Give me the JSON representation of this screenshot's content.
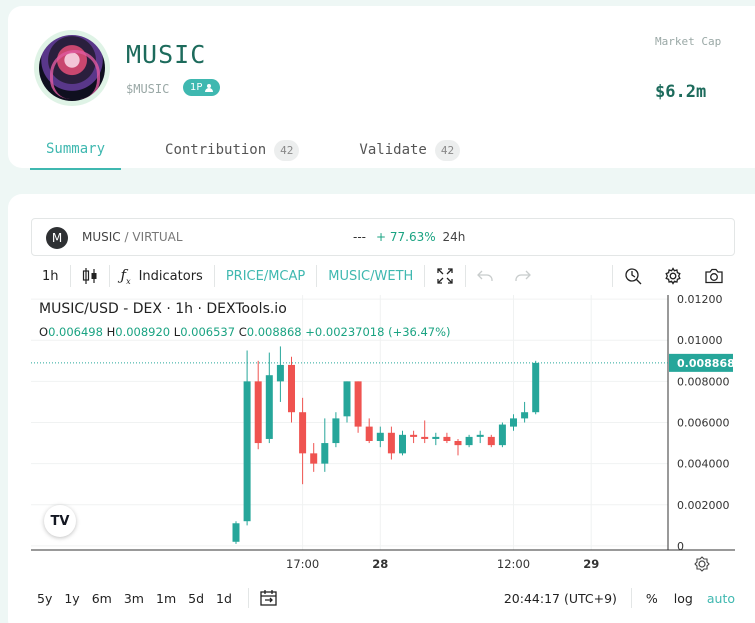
{
  "token": {
    "name": "MUSIC",
    "symbol": "$MUSIC",
    "holders_badge": "1P"
  },
  "market_cap": {
    "label": "Market Cap",
    "value": "$6.2m"
  },
  "tabs": [
    {
      "label": "Summary",
      "count": ""
    },
    {
      "label": "Contribution",
      "count": "42"
    },
    {
      "label": "Validate",
      "count": "42"
    }
  ],
  "pair": {
    "avatar_letter": "M",
    "base": "MUSIC",
    "quote": "/ VIRTUAL",
    "dash": "---",
    "change": "+ 77.63%",
    "period": "24h"
  },
  "toolbar": {
    "interval": "1h",
    "indicators_label": "Indicators",
    "price_mcap_label": "PRICE/MCAP",
    "pair_switch_label": "MUSIC/WETH",
    "icons": [
      "candle-type-icon",
      "fx-icon",
      "fullscreen-icon",
      "undo-icon",
      "redo-icon",
      "search-zoom-icon",
      "gear-icon",
      "camera-icon"
    ]
  },
  "legend": {
    "title": "MUSIC/USD - DEX · 1h · DEXTools.io",
    "o": "0.006498",
    "h": "0.008920",
    "l": "0.006537",
    "c": "0.008868",
    "change": "+0.00237018 (+36.47%)"
  },
  "tv_logo": "TV",
  "bottom_bar": {
    "ranges": [
      "5y",
      "1y",
      "6m",
      "3m",
      "1m",
      "5d",
      "1d"
    ],
    "time": "20:44:17 (UTC+9)",
    "percent": "%",
    "log": "log",
    "auto": "auto"
  },
  "chart_data": {
    "type": "candlestick",
    "title": "MUSIC/USD - DEX · 1h · DEXTools.io",
    "x_ticks": [
      {
        "label": "17:00",
        "index": 6
      },
      {
        "label": "28",
        "index": 13
      },
      {
        "label": "12:00",
        "index": 25
      },
      {
        "label": "29",
        "index": 32
      }
    ],
    "y_ticks": [
      "0",
      "0.002000",
      "0.004000",
      "0.006000",
      "0.008000",
      "0.01000",
      "0.01200"
    ],
    "ylim": [
      -0.0002,
      0.0122
    ],
    "last_price_label": "0.008868",
    "up_color": "#26a69a",
    "down_color": "#ef5350",
    "candles": [
      {
        "o": 0.0002,
        "h": 0.0012,
        "l": 0.0001,
        "c": 0.0011
      },
      {
        "o": 0.0012,
        "h": 0.0095,
        "l": 0.001,
        "c": 0.008
      },
      {
        "o": 0.008,
        "h": 0.009,
        "l": 0.0047,
        "c": 0.005
      },
      {
        "o": 0.0052,
        "h": 0.0094,
        "l": 0.005,
        "c": 0.0083
      },
      {
        "o": 0.008,
        "h": 0.0097,
        "l": 0.007,
        "c": 0.0088
      },
      {
        "o": 0.0088,
        "h": 0.0092,
        "l": 0.006,
        "c": 0.0065
      },
      {
        "o": 0.0065,
        "h": 0.0072,
        "l": 0.003,
        "c": 0.0045
      },
      {
        "o": 0.0045,
        "h": 0.005,
        "l": 0.0036,
        "c": 0.004
      },
      {
        "o": 0.004,
        "h": 0.0062,
        "l": 0.0036,
        "c": 0.005
      },
      {
        "o": 0.005,
        "h": 0.0065,
        "l": 0.0048,
        "c": 0.0062
      },
      {
        "o": 0.0063,
        "h": 0.008,
        "l": 0.006,
        "c": 0.008
      },
      {
        "o": 0.008,
        "h": 0.008,
        "l": 0.0055,
        "c": 0.0058
      },
      {
        "o": 0.0058,
        "h": 0.0062,
        "l": 0.005,
        "c": 0.0051
      },
      {
        "o": 0.0051,
        "h": 0.0058,
        "l": 0.0048,
        "c": 0.0055
      },
      {
        "o": 0.0055,
        "h": 0.0058,
        "l": 0.0042,
        "c": 0.0045
      },
      {
        "o": 0.0045,
        "h": 0.0056,
        "l": 0.0044,
        "c": 0.0054
      },
      {
        "o": 0.0054,
        "h": 0.0056,
        "l": 0.005,
        "c": 0.0053
      },
      {
        "o": 0.0053,
        "h": 0.0061,
        "l": 0.005,
        "c": 0.0052
      },
      {
        "o": 0.0052,
        "h": 0.0055,
        "l": 0.0049,
        "c": 0.0053
      },
      {
        "o": 0.0053,
        "h": 0.0055,
        "l": 0.005,
        "c": 0.0051
      },
      {
        "o": 0.0051,
        "h": 0.0052,
        "l": 0.0044,
        "c": 0.0049
      },
      {
        "o": 0.0049,
        "h": 0.0054,
        "l": 0.0048,
        "c": 0.0053
      },
      {
        "o": 0.0053,
        "h": 0.0056,
        "l": 0.005,
        "c": 0.0054
      },
      {
        "o": 0.0053,
        "h": 0.0054,
        "l": 0.0048,
        "c": 0.0049
      },
      {
        "o": 0.0049,
        "h": 0.006,
        "l": 0.0048,
        "c": 0.0059
      },
      {
        "o": 0.0058,
        "h": 0.0064,
        "l": 0.0056,
        "c": 0.0062
      },
      {
        "o": 0.0062,
        "h": 0.007,
        "l": 0.006,
        "c": 0.0065
      },
      {
        "o": 0.0065,
        "h": 0.009,
        "l": 0.0064,
        "c": 0.0089
      }
    ]
  }
}
